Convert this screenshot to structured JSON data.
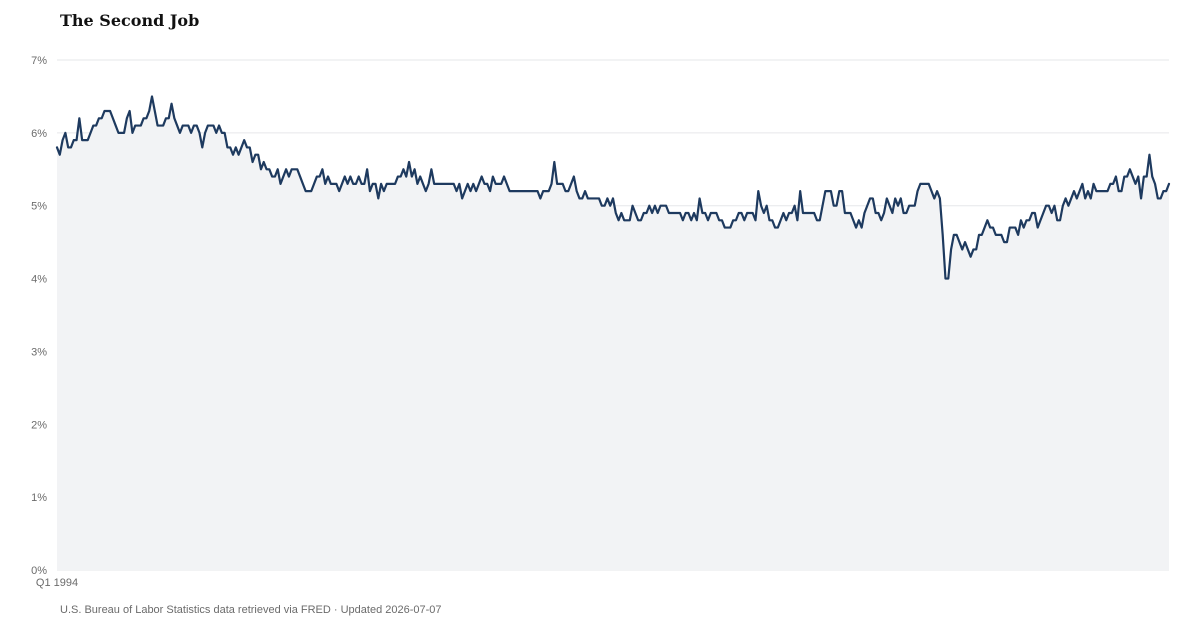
{
  "chart_data": {
    "type": "area",
    "title": "The Second Job",
    "xlabel": "",
    "ylabel": "",
    "start_label": "Q1 1994",
    "frequency": "monthly",
    "x_tick_labels": [
      "Q1 1994"
    ],
    "y_tick_labels": [
      "0%",
      "1%",
      "2%",
      "3%",
      "4%",
      "5%",
      "6%",
      "7%"
    ],
    "y_ticks": [
      0,
      1,
      2,
      3,
      4,
      5,
      6,
      7
    ],
    "ylim": [
      0,
      7
    ],
    "grid": true,
    "legend": "none",
    "series": [
      {
        "values": [
          5.8,
          5.7,
          5.9,
          6.0,
          5.8,
          5.8,
          5.9,
          5.9,
          6.2,
          5.9,
          5.9,
          5.9,
          6.0,
          6.1,
          6.1,
          6.2,
          6.2,
          6.3,
          6.3,
          6.3,
          6.2,
          6.1,
          6.0,
          6.0,
          6.0,
          6.2,
          6.3,
          6.0,
          6.1,
          6.1,
          6.1,
          6.2,
          6.2,
          6.3,
          6.5,
          6.3,
          6.1,
          6.1,
          6.1,
          6.2,
          6.2,
          6.4,
          6.2,
          6.1,
          6.0,
          6.1,
          6.1,
          6.1,
          6.0,
          6.1,
          6.1,
          6.0,
          5.8,
          6.0,
          6.1,
          6.1,
          6.1,
          6.0,
          6.1,
          6.0,
          6.0,
          5.8,
          5.8,
          5.7,
          5.8,
          5.7,
          5.8,
          5.9,
          5.8,
          5.8,
          5.6,
          5.7,
          5.7,
          5.5,
          5.6,
          5.5,
          5.5,
          5.4,
          5.4,
          5.5,
          5.3,
          5.4,
          5.5,
          5.4,
          5.5,
          5.5,
          5.5,
          5.4,
          5.3,
          5.2,
          5.2,
          5.2,
          5.3,
          5.4,
          5.4,
          5.5,
          5.3,
          5.4,
          5.3,
          5.3,
          5.3,
          5.2,
          5.3,
          5.4,
          5.3,
          5.4,
          5.3,
          5.3,
          5.4,
          5.3,
          5.3,
          5.5,
          5.2,
          5.3,
          5.3,
          5.1,
          5.3,
          5.2,
          5.3,
          5.3,
          5.3,
          5.3,
          5.4,
          5.4,
          5.5,
          5.4,
          5.6,
          5.4,
          5.5,
          5.3,
          5.4,
          5.3,
          5.2,
          5.3,
          5.5,
          5.3,
          5.3,
          5.3,
          5.3,
          5.3,
          5.3,
          5.3,
          5.3,
          5.2,
          5.3,
          5.1,
          5.2,
          5.3,
          5.2,
          5.3,
          5.2,
          5.3,
          5.4,
          5.3,
          5.3,
          5.2,
          5.4,
          5.3,
          5.3,
          5.3,
          5.4,
          5.3,
          5.2,
          5.2,
          5.2,
          5.2,
          5.2,
          5.2,
          5.2,
          5.2,
          5.2,
          5.2,
          5.2,
          5.1,
          5.2,
          5.2,
          5.2,
          5.3,
          5.6,
          5.3,
          5.3,
          5.3,
          5.2,
          5.2,
          5.3,
          5.4,
          5.2,
          5.1,
          5.1,
          5.2,
          5.1,
          5.1,
          5.1,
          5.1,
          5.1,
          5.0,
          5.0,
          5.1,
          5.0,
          5.1,
          4.9,
          4.8,
          4.9,
          4.8,
          4.8,
          4.8,
          5.0,
          4.9,
          4.8,
          4.8,
          4.9,
          4.9,
          5.0,
          4.9,
          5.0,
          4.9,
          5.0,
          5.0,
          5.0,
          4.9,
          4.9,
          4.9,
          4.9,
          4.9,
          4.8,
          4.9,
          4.9,
          4.8,
          4.9,
          4.8,
          5.1,
          4.9,
          4.9,
          4.8,
          4.9,
          4.9,
          4.9,
          4.8,
          4.8,
          4.7,
          4.7,
          4.7,
          4.8,
          4.8,
          4.9,
          4.9,
          4.8,
          4.9,
          4.9,
          4.9,
          4.8,
          5.2,
          5.0,
          4.9,
          5.0,
          4.8,
          4.8,
          4.7,
          4.7,
          4.8,
          4.9,
          4.8,
          4.9,
          4.9,
          5.0,
          4.8,
          5.2,
          4.9,
          4.9,
          4.9,
          4.9,
          4.9,
          4.8,
          4.8,
          5.0,
          5.2,
          5.2,
          5.2,
          5.0,
          5.0,
          5.2,
          5.2,
          4.9,
          4.9,
          4.9,
          4.8,
          4.7,
          4.8,
          4.7,
          4.9,
          5.0,
          5.1,
          5.1,
          4.9,
          4.9,
          4.8,
          4.9,
          5.1,
          5.0,
          4.9,
          5.1,
          5.0,
          5.1,
          4.9,
          4.9,
          5.0,
          5.0,
          5.0,
          5.2,
          5.3,
          5.3,
          5.3,
          5.3,
          5.2,
          5.1,
          5.2,
          5.1,
          4.6,
          4.0,
          4.0,
          4.4,
          4.6,
          4.6,
          4.5,
          4.4,
          4.5,
          4.4,
          4.3,
          4.4,
          4.4,
          4.6,
          4.6,
          4.7,
          4.8,
          4.7,
          4.7,
          4.6,
          4.6,
          4.6,
          4.5,
          4.5,
          4.7,
          4.7,
          4.7,
          4.6,
          4.8,
          4.7,
          4.8,
          4.8,
          4.9,
          4.9,
          4.7,
          4.8,
          4.9,
          5.0,
          5.0,
          4.9,
          5.0,
          4.8,
          4.8,
          5.0,
          5.1,
          5.0,
          5.1,
          5.2,
          5.1,
          5.2,
          5.3,
          5.1,
          5.2,
          5.1,
          5.3,
          5.2,
          5.2,
          5.2,
          5.2,
          5.2,
          5.3,
          5.3,
          5.4,
          5.2,
          5.2,
          5.4,
          5.4,
          5.5,
          5.4,
          5.3,
          5.4,
          5.1,
          5.4,
          5.4,
          5.7,
          5.4,
          5.3,
          5.1,
          5.1,
          5.2,
          5.2,
          5.3
        ]
      }
    ]
  },
  "footer": {
    "source": "U.S. Bureau of Labor Statistics data retrieved via FRED · Updated 2026-07-07"
  },
  "colors": {
    "line": "#1e3a5f",
    "area": "#f2f3f5",
    "grid": "#e6e7ea",
    "axis_text": "#6b6b6b",
    "title": "#111111"
  }
}
